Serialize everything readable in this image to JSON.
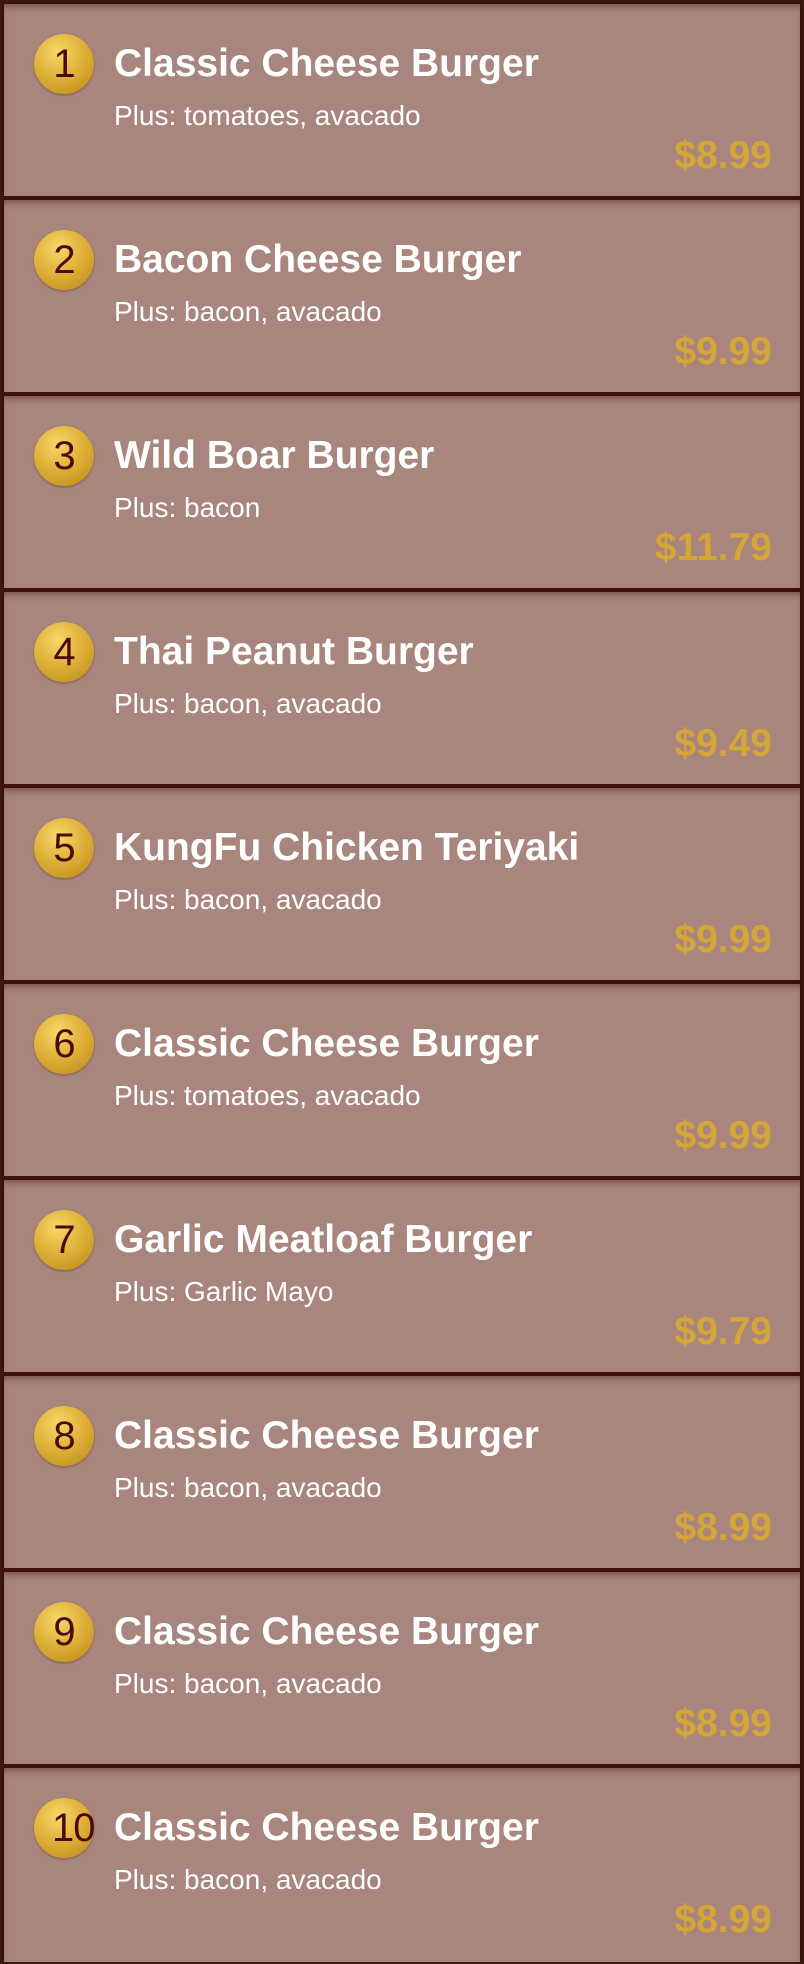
{
  "colors": {
    "row_background": "#a8857d",
    "separator": "#3f0f08",
    "badge_gold": "#e0b23a",
    "badge_text": "#4b0a06",
    "title_text": "#ffffff",
    "price_text": "#d4a637"
  },
  "menu": {
    "items": [
      {
        "number": "1",
        "name": "Classic Cheese Burger",
        "extras": "Plus: tomatoes, avacado",
        "price": "$8.99"
      },
      {
        "number": "2",
        "name": "Bacon Cheese Burger",
        "extras": "Plus: bacon, avacado",
        "price": "$9.99"
      },
      {
        "number": "3",
        "name": "Wild Boar Burger",
        "extras": "Plus: bacon",
        "price": "$11.79"
      },
      {
        "number": "4",
        "name": "Thai Peanut Burger",
        "extras": "Plus: bacon, avacado",
        "price": "$9.49"
      },
      {
        "number": "5",
        "name": "KungFu Chicken Teriyaki",
        "extras": "Plus: bacon, avacado",
        "price": "$9.99"
      },
      {
        "number": "6",
        "name": "Classic Cheese Burger",
        "extras": "Plus: tomatoes, avacado",
        "price": "$9.99"
      },
      {
        "number": "7",
        "name": "Garlic Meatloaf Burger",
        "extras": "Plus: Garlic Mayo",
        "price": "$9.79"
      },
      {
        "number": "8",
        "name": "Classic Cheese Burger",
        "extras": "Plus: bacon, avacado",
        "price": "$8.99"
      },
      {
        "number": "9",
        "name": "Classic Cheese Burger",
        "extras": "Plus: bacon, avacado",
        "price": "$8.99"
      },
      {
        "number": "10",
        "name": "Classic Cheese Burger",
        "extras": "Plus: bacon, avacado",
        "price": "$8.99"
      }
    ]
  }
}
